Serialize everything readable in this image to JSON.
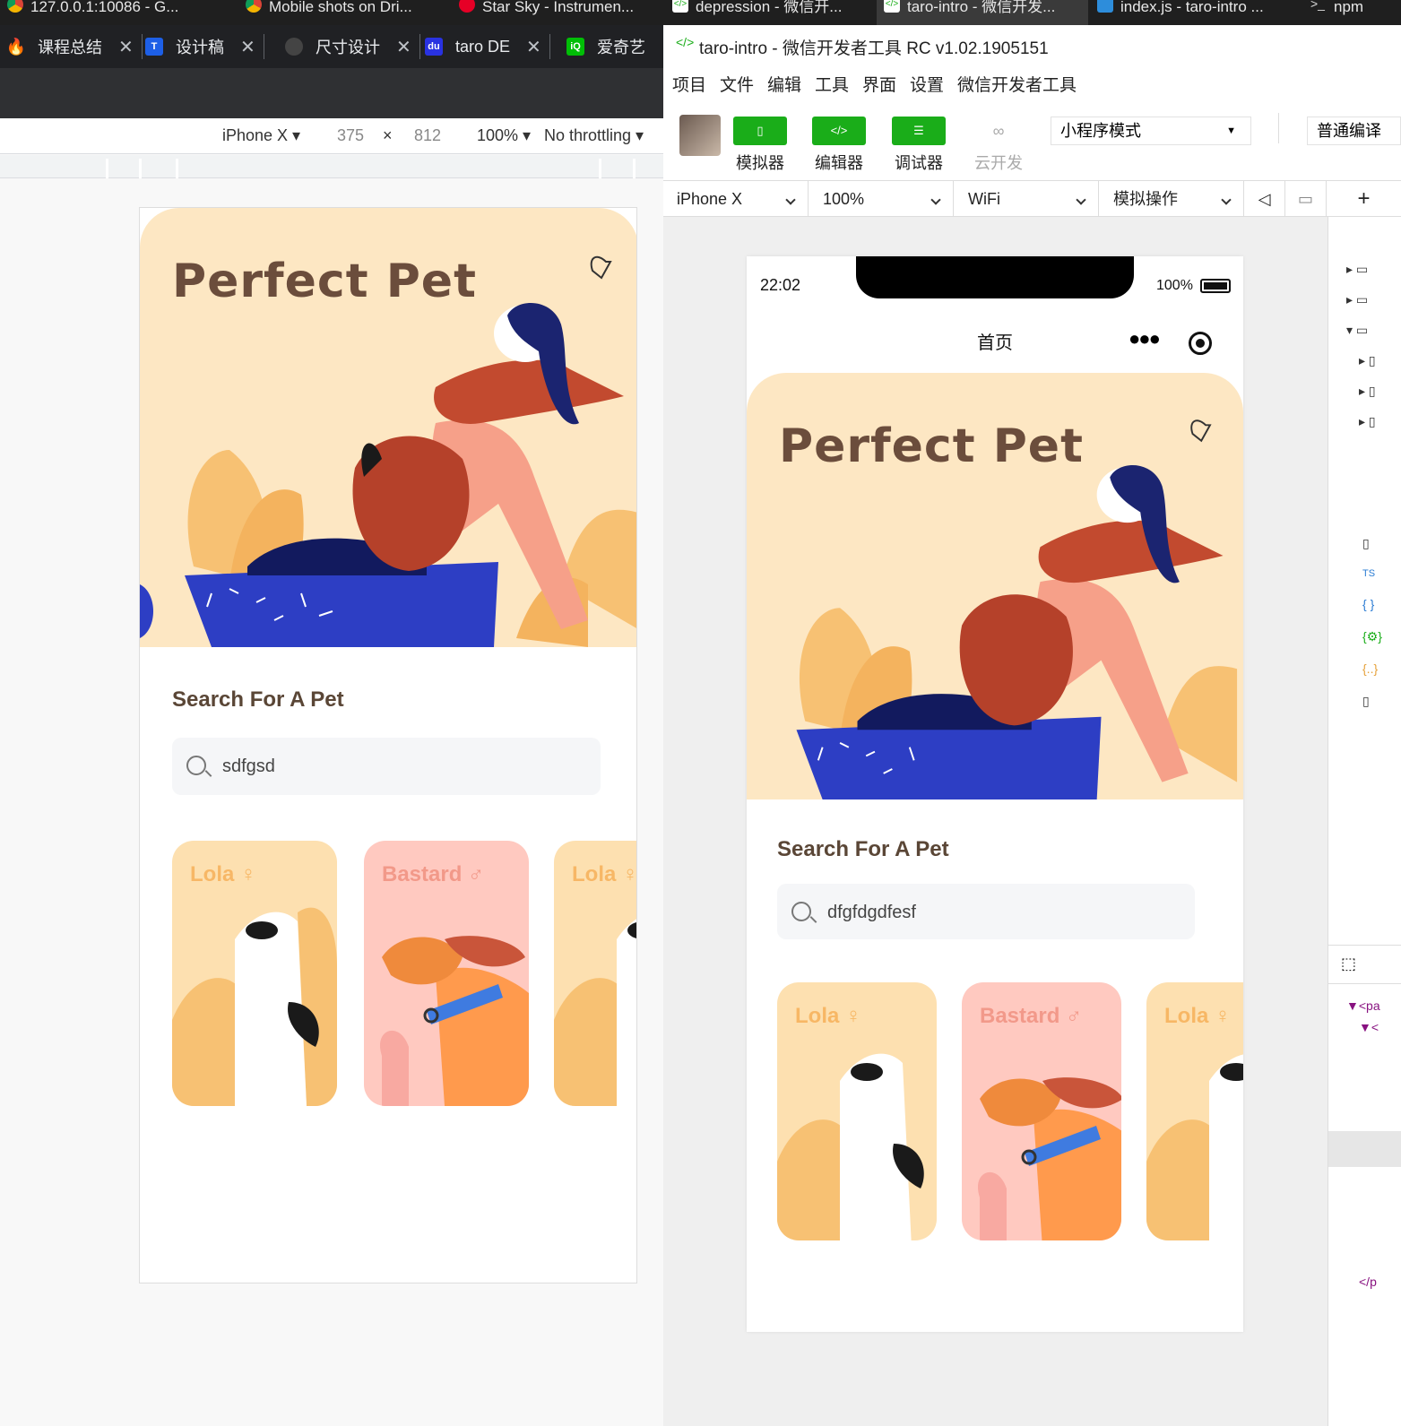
{
  "taskbar": {
    "tasks": [
      {
        "label": "127.0.0.1:10086 - G..."
      },
      {
        "label": "Mobile shots on Dri..."
      },
      {
        "label": "Star Sky - Instrumen..."
      },
      {
        "label": "depression - 微信开..."
      },
      {
        "label": "taro-intro - 微信开发..."
      },
      {
        "label": "index.js - taro-intro ..."
      },
      {
        "label": "npm"
      }
    ]
  },
  "browser": {
    "tabs": [
      {
        "label": "课程总结"
      },
      {
        "label": "设计稿"
      },
      {
        "label": "尺寸设计"
      },
      {
        "label": "taro DE"
      },
      {
        "label": "爱奇艺"
      }
    ],
    "close_glyph": "✕",
    "device": "iPhone X ▾",
    "width": "375",
    "times": "×",
    "height": "812",
    "zoom": "100% ▾",
    "throttle": "No throttling ▾"
  },
  "app_left": {
    "hero_title": "Perfect Pet",
    "section_title": "Search For A Pet",
    "search_value": "sdfgsd",
    "cards": [
      {
        "label": "Lola ♀"
      },
      {
        "label": "Bastard ♂"
      },
      {
        "label": "Lola ♀"
      }
    ]
  },
  "devtools": {
    "title": "taro-intro - 微信开发者工具 RC v1.02.1905151",
    "menu": [
      "项目",
      "文件",
      "编辑",
      "工具",
      "界面",
      "设置",
      "微信开发者工具"
    ],
    "toolbar": {
      "simulator": "模拟器",
      "editor": "编辑器",
      "debugger": "调试器",
      "cloud": "云开发",
      "mode": "小程序模式",
      "compile": "普通编译"
    },
    "device_bar": {
      "device": "iPhone X",
      "zoom": "100%",
      "network": "WiFi",
      "ops": "模拟操作",
      "add": "+"
    },
    "phone": {
      "time": "22:02",
      "battery": "100%",
      "nav_title": "首页",
      "hero_title": "Perfect Pet",
      "section_title": "Search For A Pet",
      "search_value": "dfgfdgdfesf",
      "cards": [
        {
          "label": "Lola ♀"
        },
        {
          "label": "Bastard ♂"
        },
        {
          "label": "Lola ♀"
        }
      ]
    },
    "tree": {
      "ts_badge": "TS",
      "braces": "{ }",
      "settings_braces": "{⚙}",
      "dots_braces": "{..}",
      "code1": "▼<pa",
      "code2": "▼<",
      "code3": "</p"
    }
  },
  "colors": {
    "hero_bg": "#fde7c3",
    "title_brown": "#6b4d3c",
    "wechat_green": "#1aad19",
    "card_yellow": "#fde0b0",
    "card_pink": "#ffc9c0"
  }
}
